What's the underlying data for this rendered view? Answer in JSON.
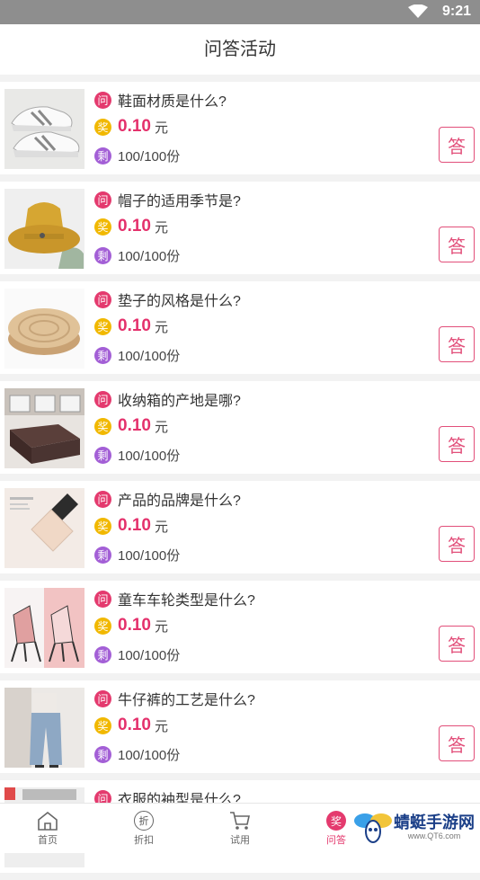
{
  "status_bar": {
    "time": "9:21"
  },
  "header": {
    "title": "问答活动"
  },
  "badge_labels": {
    "ask": "问",
    "prize": "奖",
    "remaining": "剩"
  },
  "answer_button_label": "答",
  "unit": "元",
  "items": [
    {
      "question": "鞋面材质是什么?",
      "reward": "0.10",
      "remaining": "100/100份",
      "image": "sneakers"
    },
    {
      "question": "帽子的适用季节是?",
      "reward": "0.10",
      "remaining": "100/100份",
      "image": "bucket-hat"
    },
    {
      "question": "垫子的风格是什么?",
      "reward": "0.10",
      "remaining": "100/100份",
      "image": "straw-cushion"
    },
    {
      "question": "收纳箱的产地是哪?",
      "reward": "0.10",
      "remaining": "100/100份",
      "image": "storage-box"
    },
    {
      "question": "产品的品牌是什么?",
      "reward": "0.10",
      "remaining": "100/100份",
      "image": "foundation-bottle"
    },
    {
      "question": "童车车轮类型是什么?",
      "reward": "0.10",
      "remaining": "100/100份",
      "image": "strollers"
    },
    {
      "question": "牛仔裤的工艺是什么?",
      "reward": "0.10",
      "remaining": "100/100份",
      "image": "jeans"
    },
    {
      "question": "衣服的袖型是什么?",
      "reward": "",
      "remaining": "",
      "image": "clothing"
    }
  ],
  "tabbar": {
    "tabs": [
      {
        "label": "首页",
        "icon": "home-icon"
      },
      {
        "label": "折扣",
        "icon": "discount-icon",
        "glyph": "折"
      },
      {
        "label": "试用",
        "icon": "cart-icon"
      },
      {
        "label": "问答",
        "icon": "prize-icon",
        "glyph": "奖",
        "active": true
      }
    ]
  },
  "watermark": {
    "text": "蜻蜓手游网",
    "url": "www.QT6.com"
  },
  "colors": {
    "accent": "#e43a6e",
    "prize": "#f1b800",
    "remaining": "#a35fd6",
    "status_bar": "#8e8e8e"
  }
}
